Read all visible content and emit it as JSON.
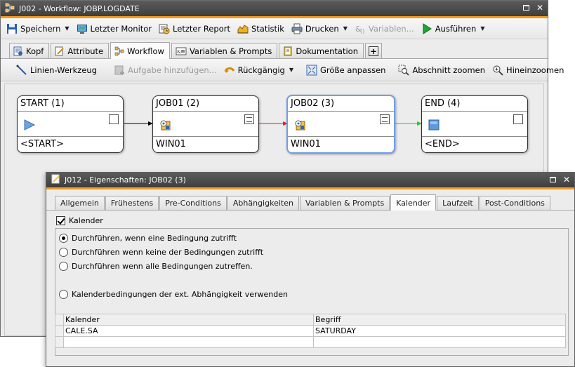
{
  "main_window": {
    "title": "J002 - Workflow: JOBP.LOGDATE"
  },
  "toolbar": {
    "save": "Speichern",
    "last_monitor": "Letzter Monitor",
    "last_report": "Letzter Report",
    "statistics": "Statistik",
    "print": "Drucken",
    "variables": "Variablen...",
    "execute": "Ausführen"
  },
  "tabs": [
    {
      "label": "Kopf",
      "active": false
    },
    {
      "label": "Attribute",
      "active": false
    },
    {
      "label": "Workflow",
      "active": true
    },
    {
      "label": "Variablen & Prompts",
      "active": false
    },
    {
      "label": "Dokumentation",
      "active": false
    }
  ],
  "workflow_toolbar": {
    "line_tool": "Linien-Werkzeug",
    "add_task": "Aufgabe hinzufügen...",
    "undo": "Rückgängig",
    "fit_size": "Größe anpassen",
    "zoom_section": "Abschnitt zoomen",
    "zoom_in": "Hineinzoomen",
    "more": "»"
  },
  "nodes": [
    {
      "title": "START (1)",
      "footer": "<START>"
    },
    {
      "title": "JOB01 (2)",
      "footer": "WIN01"
    },
    {
      "title": "JOB02 (3)",
      "footer": "WIN01"
    },
    {
      "title": "END (4)",
      "footer": "<END>"
    }
  ],
  "colors": {
    "edge_1_2": "#000000",
    "edge_2_3": "#e8201e",
    "edge_3_4": "#22cc22",
    "accent": "#f39a1e",
    "selection": "#6f9ee8"
  },
  "dialog": {
    "title": "J012 - Eigenschaften: JOB02 (3)",
    "tabs": [
      {
        "label": "Allgemein",
        "active": false
      },
      {
        "label": "Frühestens",
        "active": false
      },
      {
        "label": "Pre-Conditions",
        "active": false
      },
      {
        "label": "Abhängigkeiten",
        "active": false
      },
      {
        "label": "Variablen & Prompts",
        "active": false
      },
      {
        "label": "Kalender",
        "active": true
      },
      {
        "label": "Laufzeit",
        "active": false
      },
      {
        "label": "Post-Conditions",
        "active": false
      }
    ],
    "calendar_checkbox": "Kalender",
    "options": [
      {
        "label": "Durchführen, wenn eine Bedingung zutrifft",
        "selected": true
      },
      {
        "label": "Durchführen wenn keine der Bedingungen zutrifft",
        "selected": false
      },
      {
        "label": "Durchführen wenn alle Bedingungen zutreffen.",
        "selected": false
      },
      {
        "label": "Kalenderbedingungen der ext. Abhängigkeit verwenden",
        "selected": false
      }
    ],
    "table": {
      "columns": [
        "Kalender",
        "Begriff"
      ],
      "rows": [
        [
          "CALE.SA",
          "SATURDAY"
        ],
        [
          "",
          ""
        ]
      ]
    }
  }
}
